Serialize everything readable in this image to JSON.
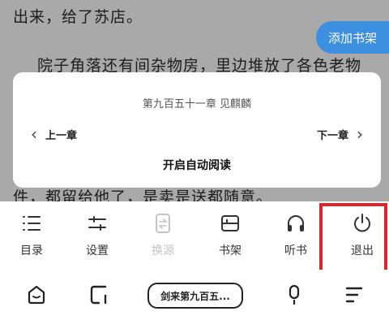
{
  "reader": {
    "lines": [
      "出来，给了苏店。",
      "院子角落还有间杂物房，里边堆放了各色老物",
      "件，都留给他了，是卖是送都随意。"
    ],
    "add_to_shelf": "添加书架"
  },
  "chapter_card": {
    "title": "第九百五十一章 见麒麟",
    "prev_label": "上一章",
    "next_label": "下一章",
    "auto_read_label": "开启自动阅读"
  },
  "menu": {
    "items": [
      {
        "label": "目录",
        "icon": "list-icon",
        "enabled": true
      },
      {
        "label": "设置",
        "icon": "sliders-icon",
        "enabled": true
      },
      {
        "label": "换源",
        "icon": "swap-source-icon",
        "enabled": false
      },
      {
        "label": "书架",
        "icon": "bookshelf-icon",
        "enabled": true
      },
      {
        "label": "听书",
        "icon": "headphones-icon",
        "enabled": true
      },
      {
        "label": "退出",
        "icon": "power-icon",
        "enabled": true
      }
    ]
  },
  "nav": {
    "book_title": "剑来第九百五..."
  },
  "colors": {
    "accent": "#3d8fe0",
    "highlight": "#d22a2a",
    "disabled": "#c4c4c4"
  }
}
